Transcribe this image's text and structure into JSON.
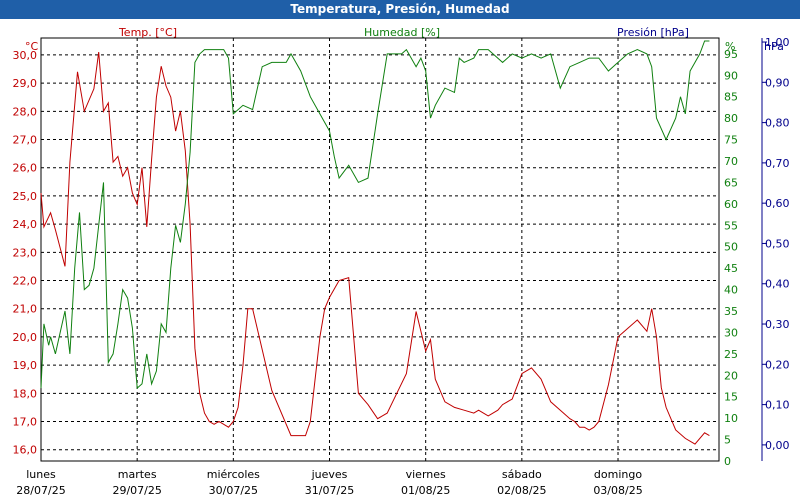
{
  "window": {
    "title": "Temperatura, Presión, Humedad"
  },
  "colors": {
    "temperature": "#c00000",
    "humidity": "#108010",
    "pressure": "#00008b",
    "titlebar": "#1f5fa8",
    "grid": "#000000"
  },
  "chart_data": {
    "type": "line",
    "title": "Temperatura, Presión, Humedad",
    "grid": true,
    "x_ticks": [
      {
        "day": "lunes",
        "date": "28/07/25"
      },
      {
        "day": "martes",
        "date": "29/07/25"
      },
      {
        "day": "miércoles",
        "date": "30/07/25"
      },
      {
        "day": "jueves",
        "date": "31/07/25"
      },
      {
        "day": "viernes",
        "date": "01/08/25"
      },
      {
        "day": "sábado",
        "date": "02/08/25"
      },
      {
        "day": "domingo",
        "date": "03/08/25"
      }
    ],
    "x_range_days": [
      0,
      7.05
    ],
    "axes": {
      "temperature": {
        "label": "Temp. [°C]",
        "unit": "°C",
        "range": [
          15.6,
          30.6
        ],
        "ticks": [
          "30,0",
          "29,0",
          "28,0",
          "27,0",
          "26,0",
          "25,0",
          "24,0",
          "23,0",
          "22,0",
          "21,0",
          "20,0",
          "19,0",
          "18,0",
          "17,0",
          "16,0"
        ]
      },
      "humidity": {
        "label": "Humedad [%]",
        "unit": "%",
        "range": [
          0,
          98.7
        ],
        "ticks": [
          "95",
          "90",
          "85",
          "80",
          "75",
          "70",
          "65",
          "60",
          "55",
          "50",
          "45",
          "40",
          "35",
          "30",
          "25",
          "20",
          "15",
          "10",
          "5",
          "0"
        ]
      },
      "pressure": {
        "label": "Presión [hPa]",
        "unit": "hPa",
        "range": [
          -0.04,
          1.01
        ],
        "ticks": [
          "1,00",
          "0,90",
          "0,80",
          "0,70",
          "0,60",
          "0,50",
          "0,40",
          "0,30",
          "0,20",
          "0,10",
          "0,00"
        ]
      }
    },
    "series": [
      {
        "name": "Temp. [°C]",
        "axis": "temperature",
        "x": [
          0,
          0.03,
          0.1,
          0.15,
          0.25,
          0.3,
          0.38,
          0.45,
          0.55,
          0.6,
          0.65,
          0.7,
          0.75,
          0.8,
          0.85,
          0.9,
          0.95,
          1,
          1.05,
          1.1,
          1.15,
          1.2,
          1.25,
          1.3,
          1.35,
          1.4,
          1.45,
          1.5,
          1.55,
          1.6,
          1.65,
          1.7,
          1.75,
          1.8,
          1.85,
          1.9,
          1.95,
          2,
          2.05,
          2.1,
          2.15,
          2.2,
          2.4,
          2.6,
          2.75,
          2.8,
          2.9,
          2.95,
          3,
          3.1,
          3.2,
          3.3,
          3.4,
          3.5,
          3.6,
          3.7,
          3.8,
          3.9,
          3.95,
          4,
          4.05,
          4.1,
          4.2,
          4.3,
          4.4,
          4.5,
          4.55,
          4.6,
          4.65,
          4.7,
          4.75,
          4.8,
          4.9,
          5,
          5.1,
          5.2,
          5.3,
          5.4,
          5.5,
          5.55,
          5.6,
          5.65,
          5.7,
          5.75,
          5.8,
          5.9,
          6,
          6.1,
          6.2,
          6.3,
          6.35,
          6.4,
          6.45,
          6.5,
          6.55,
          6.6,
          6.7,
          6.8,
          6.9,
          6.95
        ],
        "y": [
          25.1,
          23.9,
          24.4,
          23.8,
          22.5,
          26.2,
          29.4,
          28.0,
          28.8,
          30.1,
          28.0,
          28.3,
          26.2,
          26.4,
          25.7,
          26.0,
          25.1,
          24.7,
          26.0,
          23.9,
          26.3,
          28.5,
          29.6,
          28.9,
          28.5,
          27.3,
          28.0,
          26.6,
          24.0,
          19.6,
          18.0,
          17.3,
          17.0,
          16.9,
          17.0,
          16.9,
          16.8,
          17.0,
          17.5,
          19.0,
          21.0,
          21.0,
          18.1,
          16.5,
          16.5,
          17.0,
          20.0,
          21.0,
          21.4,
          22.0,
          22.1,
          18.0,
          17.6,
          17.1,
          17.3,
          18.0,
          18.7,
          20.9,
          20.2,
          19.5,
          19.9,
          18.5,
          17.7,
          17.5,
          17.4,
          17.3,
          17.4,
          17.3,
          17.2,
          17.3,
          17.4,
          17.6,
          17.8,
          18.7,
          18.9,
          18.5,
          17.7,
          17.4,
          17.1,
          17.0,
          16.8,
          16.8,
          16.7,
          16.8,
          17.0,
          18.3,
          20.0,
          20.3,
          20.6,
          20.2,
          21.0,
          20.0,
          18.2,
          17.5,
          17.1,
          16.7,
          16.4,
          16.2,
          16.6,
          16.5
        ]
      },
      {
        "name": "Humedad [%]",
        "axis": "humidity",
        "x": [
          0,
          0.03,
          0.08,
          0.1,
          0.15,
          0.2,
          0.25,
          0.3,
          0.35,
          0.4,
          0.45,
          0.5,
          0.55,
          0.6,
          0.65,
          0.7,
          0.75,
          0.8,
          0.85,
          0.9,
          0.95,
          1,
          1.05,
          1.1,
          1.15,
          1.2,
          1.25,
          1.3,
          1.35,
          1.4,
          1.45,
          1.5,
          1.55,
          1.6,
          1.65,
          1.7,
          1.75,
          1.8,
          1.85,
          1.9,
          1.95,
          2,
          2.1,
          2.2,
          2.3,
          2.4,
          2.5,
          2.55,
          2.6,
          2.7,
          2.8,
          2.9,
          3,
          3.05,
          3.1,
          3.2,
          3.3,
          3.4,
          3.5,
          3.6,
          3.65,
          3.7,
          3.75,
          3.8,
          3.9,
          3.95,
          4,
          4.05,
          4.1,
          4.2,
          4.3,
          4.35,
          4.4,
          4.5,
          4.55,
          4.6,
          4.65,
          4.7,
          4.8,
          4.9,
          5,
          5.1,
          5.2,
          5.3,
          5.4,
          5.5,
          5.6,
          5.7,
          5.8,
          5.9,
          6,
          6.1,
          6.2,
          6.3,
          6.35,
          6.4,
          6.5,
          6.6,
          6.65,
          6.7,
          6.75,
          6.8,
          6.85,
          6.9,
          6.95
        ],
        "y": [
          17,
          32,
          27,
          29,
          25,
          30,
          35,
          25,
          45,
          58,
          40,
          41,
          45,
          55,
          65,
          23,
          25,
          32,
          40,
          38,
          31,
          17,
          18,
          25,
          18,
          21,
          32,
          30,
          45,
          55,
          51,
          60,
          72,
          93,
          95,
          96,
          96,
          96,
          96,
          96,
          94,
          81,
          83,
          82,
          92,
          93,
          93,
          93,
          95,
          91,
          85,
          81,
          77,
          71,
          66,
          69,
          65,
          66,
          81,
          95,
          95,
          95,
          95,
          96,
          92,
          94,
          91,
          80,
          83,
          87,
          86,
          94,
          93,
          94,
          96,
          96,
          96,
          95,
          93,
          95,
          94,
          95,
          94,
          95,
          87,
          92,
          93,
          94,
          94,
          91,
          93,
          95,
          96,
          95,
          92,
          80,
          75,
          80,
          85,
          81,
          91,
          93,
          95,
          98,
          98
        ]
      },
      {
        "name": "Presión [hPa]",
        "axis": "pressure",
        "x": [],
        "y": []
      }
    ]
  }
}
